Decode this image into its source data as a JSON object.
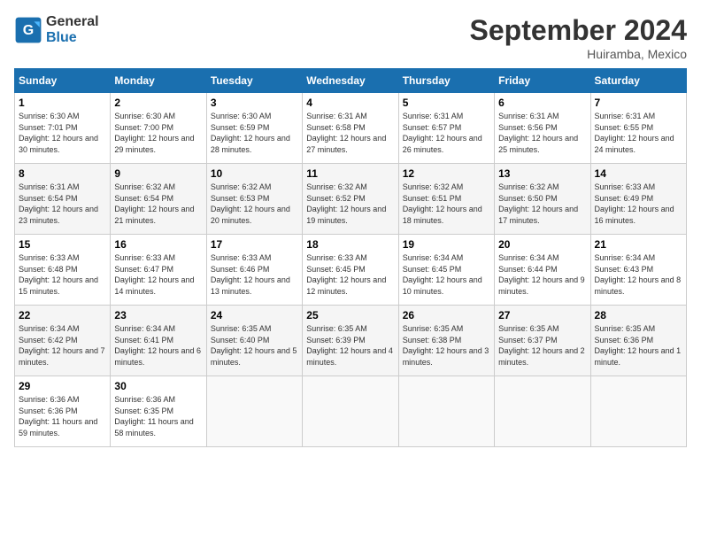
{
  "header": {
    "logo_line1": "General",
    "logo_line2": "Blue",
    "month": "September 2024",
    "location": "Huiramba, Mexico"
  },
  "days_of_week": [
    "Sunday",
    "Monday",
    "Tuesday",
    "Wednesday",
    "Thursday",
    "Friday",
    "Saturday"
  ],
  "weeks": [
    [
      {
        "day": "1",
        "sunrise": "6:30 AM",
        "sunset": "7:01 PM",
        "daylight": "12 hours and 30 minutes."
      },
      {
        "day": "2",
        "sunrise": "6:30 AM",
        "sunset": "7:00 PM",
        "daylight": "12 hours and 29 minutes."
      },
      {
        "day": "3",
        "sunrise": "6:30 AM",
        "sunset": "6:59 PM",
        "daylight": "12 hours and 28 minutes."
      },
      {
        "day": "4",
        "sunrise": "6:31 AM",
        "sunset": "6:58 PM",
        "daylight": "12 hours and 27 minutes."
      },
      {
        "day": "5",
        "sunrise": "6:31 AM",
        "sunset": "6:57 PM",
        "daylight": "12 hours and 26 minutes."
      },
      {
        "day": "6",
        "sunrise": "6:31 AM",
        "sunset": "6:56 PM",
        "daylight": "12 hours and 25 minutes."
      },
      {
        "day": "7",
        "sunrise": "6:31 AM",
        "sunset": "6:55 PM",
        "daylight": "12 hours and 24 minutes."
      }
    ],
    [
      {
        "day": "8",
        "sunrise": "6:31 AM",
        "sunset": "6:54 PM",
        "daylight": "12 hours and 23 minutes."
      },
      {
        "day": "9",
        "sunrise": "6:32 AM",
        "sunset": "6:54 PM",
        "daylight": "12 hours and 21 minutes."
      },
      {
        "day": "10",
        "sunrise": "6:32 AM",
        "sunset": "6:53 PM",
        "daylight": "12 hours and 20 minutes."
      },
      {
        "day": "11",
        "sunrise": "6:32 AM",
        "sunset": "6:52 PM",
        "daylight": "12 hours and 19 minutes."
      },
      {
        "day": "12",
        "sunrise": "6:32 AM",
        "sunset": "6:51 PM",
        "daylight": "12 hours and 18 minutes."
      },
      {
        "day": "13",
        "sunrise": "6:32 AM",
        "sunset": "6:50 PM",
        "daylight": "12 hours and 17 minutes."
      },
      {
        "day": "14",
        "sunrise": "6:33 AM",
        "sunset": "6:49 PM",
        "daylight": "12 hours and 16 minutes."
      }
    ],
    [
      {
        "day": "15",
        "sunrise": "6:33 AM",
        "sunset": "6:48 PM",
        "daylight": "12 hours and 15 minutes."
      },
      {
        "day": "16",
        "sunrise": "6:33 AM",
        "sunset": "6:47 PM",
        "daylight": "12 hours and 14 minutes."
      },
      {
        "day": "17",
        "sunrise": "6:33 AM",
        "sunset": "6:46 PM",
        "daylight": "12 hours and 13 minutes."
      },
      {
        "day": "18",
        "sunrise": "6:33 AM",
        "sunset": "6:45 PM",
        "daylight": "12 hours and 12 minutes."
      },
      {
        "day": "19",
        "sunrise": "6:34 AM",
        "sunset": "6:45 PM",
        "daylight": "12 hours and 10 minutes."
      },
      {
        "day": "20",
        "sunrise": "6:34 AM",
        "sunset": "6:44 PM",
        "daylight": "12 hours and 9 minutes."
      },
      {
        "day": "21",
        "sunrise": "6:34 AM",
        "sunset": "6:43 PM",
        "daylight": "12 hours and 8 minutes."
      }
    ],
    [
      {
        "day": "22",
        "sunrise": "6:34 AM",
        "sunset": "6:42 PM",
        "daylight": "12 hours and 7 minutes."
      },
      {
        "day": "23",
        "sunrise": "6:34 AM",
        "sunset": "6:41 PM",
        "daylight": "12 hours and 6 minutes."
      },
      {
        "day": "24",
        "sunrise": "6:35 AM",
        "sunset": "6:40 PM",
        "daylight": "12 hours and 5 minutes."
      },
      {
        "day": "25",
        "sunrise": "6:35 AM",
        "sunset": "6:39 PM",
        "daylight": "12 hours and 4 minutes."
      },
      {
        "day": "26",
        "sunrise": "6:35 AM",
        "sunset": "6:38 PM",
        "daylight": "12 hours and 3 minutes."
      },
      {
        "day": "27",
        "sunrise": "6:35 AM",
        "sunset": "6:37 PM",
        "daylight": "12 hours and 2 minutes."
      },
      {
        "day": "28",
        "sunrise": "6:35 AM",
        "sunset": "6:36 PM",
        "daylight": "12 hours and 1 minute."
      }
    ],
    [
      {
        "day": "29",
        "sunrise": "6:36 AM",
        "sunset": "6:36 PM",
        "daylight": "11 hours and 59 minutes."
      },
      {
        "day": "30",
        "sunrise": "6:36 AM",
        "sunset": "6:35 PM",
        "daylight": "11 hours and 58 minutes."
      },
      null,
      null,
      null,
      null,
      null
    ]
  ]
}
